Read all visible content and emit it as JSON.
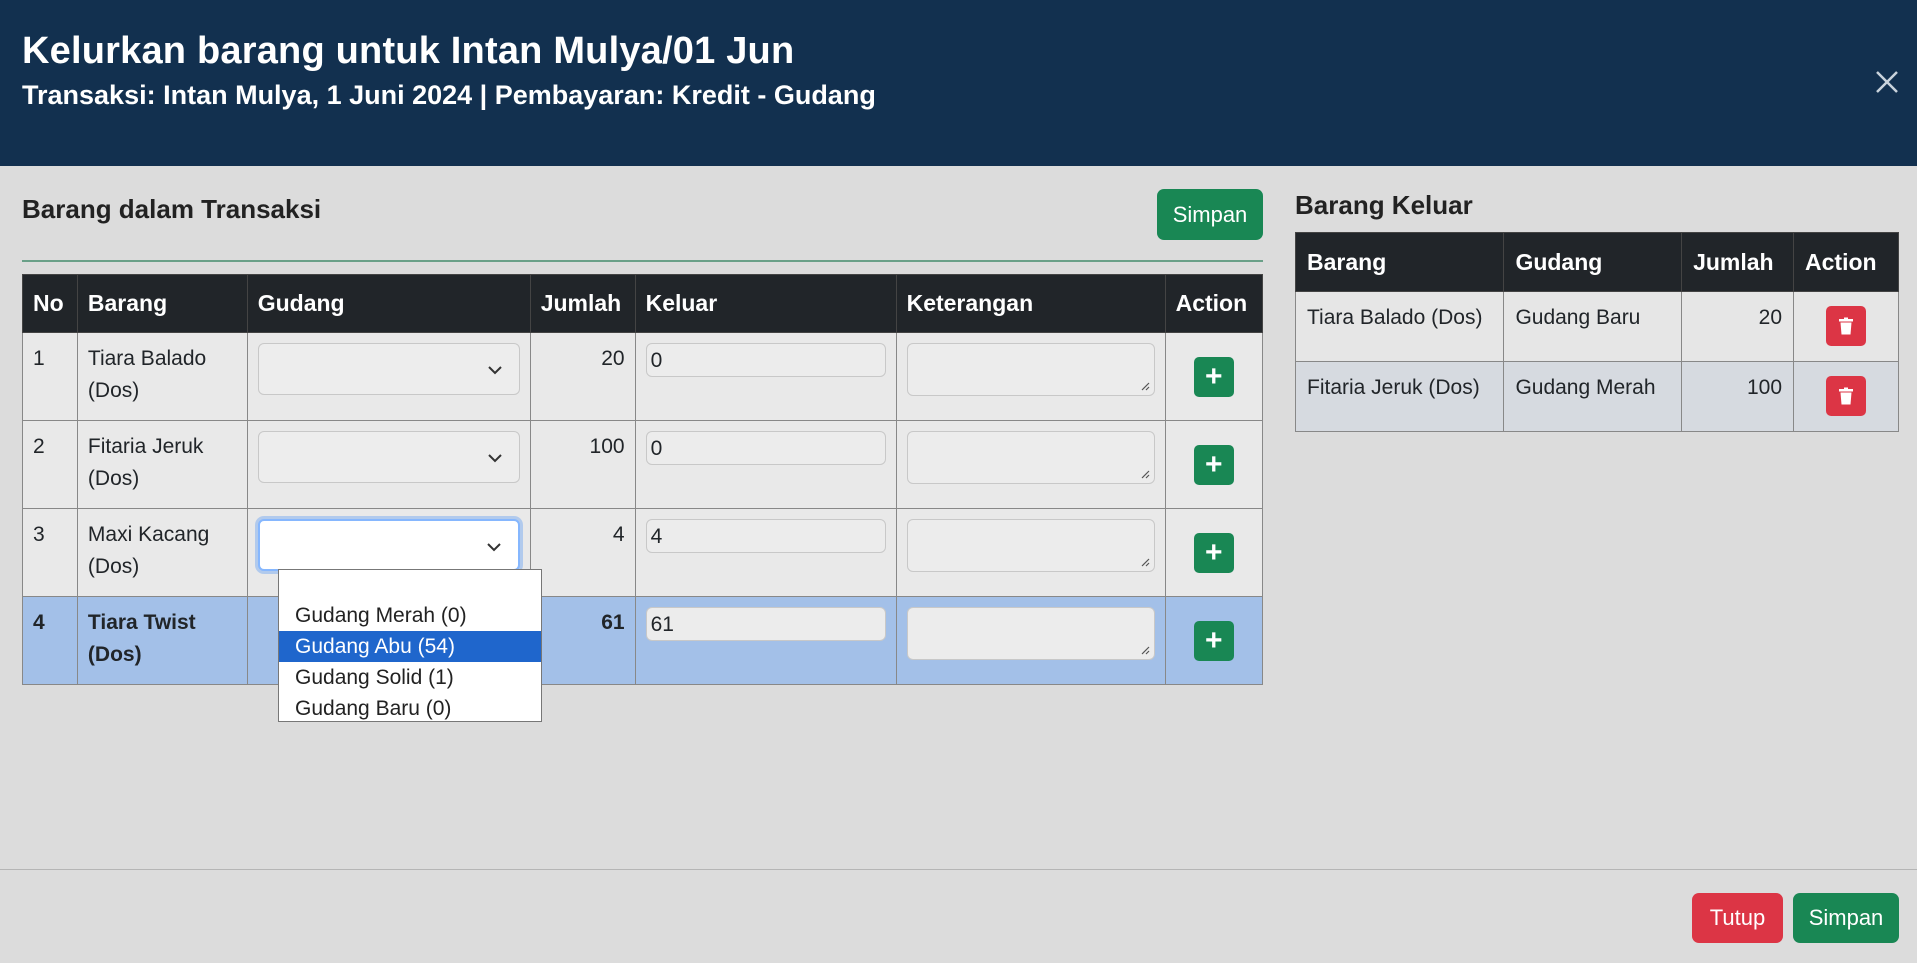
{
  "modal": {
    "title": "Kelurkan barang untuk Intan Mulya/01 Jun",
    "subtitle": "Transaksi: Intan Mulya, 1 Juni 2024 | Pembayaran: Kredit - Gudang"
  },
  "left": {
    "title": "Barang dalam Transaksi",
    "save_label": "Simpan",
    "columns": [
      "No",
      "Barang",
      "Gudang",
      "Jumlah",
      "Keluar",
      "Keterangan",
      "Action"
    ],
    "rows": [
      {
        "no": "1",
        "barang": "Tiara Balado (Dos)",
        "gudang": "",
        "jumlah": "20",
        "keluar": "0",
        "keterangan": ""
      },
      {
        "no": "2",
        "barang": "Fitaria Jeruk (Dos)",
        "gudang": "",
        "jumlah": "100",
        "keluar": "0",
        "keterangan": ""
      },
      {
        "no": "3",
        "barang": "Maxi Kacang (Dos)",
        "gudang": "",
        "jumlah": "4",
        "keluar": "4",
        "keterangan": ""
      },
      {
        "no": "4",
        "barang": "Tiara Twist (Dos)",
        "gudang": "",
        "jumlah": "61",
        "keluar": "61",
        "keterangan": ""
      }
    ],
    "add_label": "+",
    "dropdown_options": [
      "",
      "Gudang Merah (0)",
      "Gudang Abu (54)",
      "Gudang Solid (1)",
      "Gudang Baru (0)"
    ]
  },
  "right": {
    "title": "Barang Keluar",
    "columns": [
      "Barang",
      "Gudang",
      "Jumlah",
      "Action"
    ],
    "rows": [
      {
        "barang": "Tiara Balado (Dos)",
        "gudang": "Gudang Baru",
        "jumlah": "20"
      },
      {
        "barang": "Fitaria Jeruk (Dos)",
        "gudang": "Gudang Merah",
        "jumlah": "100"
      }
    ]
  },
  "footer": {
    "close_label": "Tutup",
    "save_label": "Simpan"
  },
  "colors": {
    "header_bg": "#12304f",
    "success": "#198754",
    "danger": "#dc3545",
    "selected_row": "#a3c0e8",
    "dropdown_highlight": "#1f66cc"
  },
  "icons": [
    "close-icon",
    "chevron-down-icon",
    "plus-icon",
    "trash-icon",
    "resize-grip-icon"
  ]
}
